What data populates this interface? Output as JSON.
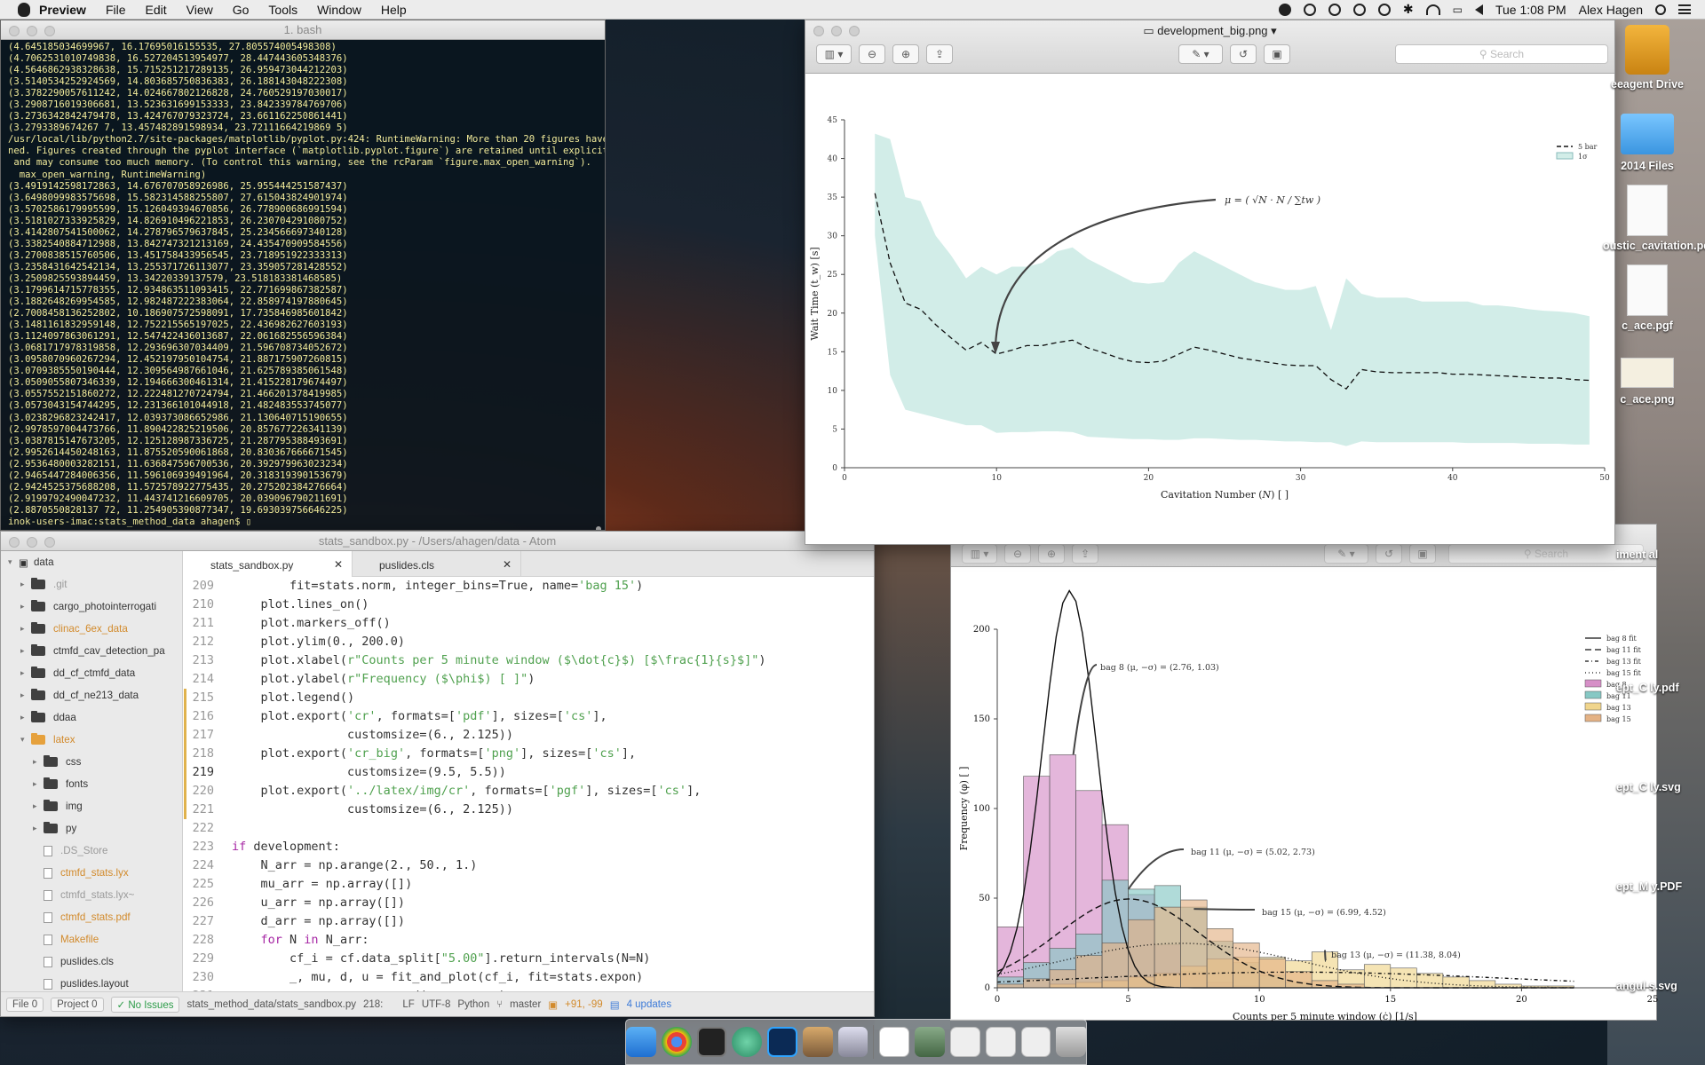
{
  "menubar": {
    "app_name": "Preview",
    "menus": [
      "File",
      "Edit",
      "View",
      "Go",
      "Tools",
      "Window",
      "Help"
    ],
    "clock": "Tue 1:08 PM",
    "user": "Alex Hagen"
  },
  "terminal": {
    "title": "1. bash",
    "lines": [
      "(4.645185034699967, 16.17695016155535, 27.805574005498308)",
      "(4.7062531010749838, 16.527204513954977, 28.447443605348376)",
      "(4.5646862938328638, 15.715251217289135, 26.959473044212203)",
      "(3.5140534252924569, 14.803685750836383, 26.188143048222308)",
      "(3.3782290057611242, 14.024667802126828, 24.760529197030017)",
      "(3.2908716019306681, 13.523631699153333, 23.842339784769706)",
      "(3.2736342842479478, 13.424767079323724, 23.661162250861441)",
      "(3.2793389674267 7, 13.457482891598934, 23.72111664219869 5)",
      "/usr/local/lib/python2.7/site-packages/matplotlib/pyplot.py:424: RuntimeWarning: More than 20 figures have been ope",
      "ned. Figures created through the pyplot interface (`matplotlib.pyplot.figure`) are retained until explicitly closed",
      " and may consume too much memory. (To control this warning, see the rcParam `figure.max_open_warning`).",
      "  max_open_warning, RuntimeWarning)",
      "(3.4919142598172863, 14.676707058926986, 25.955444251587437)",
      "(3.6498099983575698, 15.582314588255807, 27.615043824901974)",
      "(3.5702586179995599, 15.126049394670856, 26.778900686991594)",
      "(3.5181027333925829, 14.826910496221853, 26.230704291080752)",
      "(3.4142807541500062, 14.278796579637845, 25.234566697340128)",
      "(3.3382540884712988, 13.842747321213169, 24.435470909584556)",
      "(3.2700838515760506, 13.451758433956545, 23.718951922333313)",
      "(3.2358431642542134, 13.255371726113077, 23.359057281428552)",
      "(3.2509825593894459, 13.34220339137579, 23.518183381468585)",
      "(3.1799614715778355, 12.934863511093415, 22.771699867382587)",
      "(3.1882648269954585, 12.982487222383064, 22.858974197880645)",
      "(2.7008458136252802, 10.186907572598091, 17.735846985601842)",
      "(3.1481161832959148, 12.752215565197025, 22.436982627603193)",
      "(3.1124097863061291, 12.547422436013687, 22.061682556596384)",
      "(3.0681717978319858, 12.293696307034409, 21.596708734052672)",
      "(3.0958070960267294, 12.452197950104754, 21.887175907260815)",
      "(3.0709385550190444, 12.309564987661046, 21.625789385061548)",
      "(3.0509055807346339, 12.194666300461314, 21.415228179674497)",
      "(3.0557552151860272, 12.222481270724794, 21.466201378419985)",
      "(3.0573043154744295, 12.231366101044918, 21.482483553745077)",
      "(3.0238296823242417, 12.039373086652986, 21.130640715190655)",
      "(2.9978597004473766, 11.890422825219506, 20.857677226341139)",
      "(3.0387815147673205, 12.125128987336725, 21.287795388493691)",
      "(2.9952614450248163, 11.875520590061868, 20.830367666671545)",
      "(2.9536480003282151, 11.636847596700536, 20.392979963023234)",
      "(2.9465447284006356, 11.596106939491964, 20.318319390153679)",
      "(2.9424525375688208, 11.572578922775435, 20.275202384276664)",
      "(2.9199792490047232, 11.443741216609705, 20.039096790211691)",
      "(2.8870550828137 72, 11.254905390877347, 19.693039756646225)",
      "inok-users-imac:stats_method_data ahagen$ "
    ]
  },
  "preview1": {
    "title": "development_big.png",
    "search_placeholder": "Search"
  },
  "preview2": {
    "search_placeholder": "Search"
  },
  "atom": {
    "title": "stats_sandbox.py - /Users/ahagen/data - Atom",
    "tree": [
      {
        "label": "data",
        "kind": "root"
      },
      {
        "label": ".git",
        "kind": "folder",
        "lvl": 1,
        "dim": true
      },
      {
        "label": "cargo_photointerrogati",
        "kind": "folder",
        "lvl": 1
      },
      {
        "label": "clinac_6ex_data",
        "kind": "folder",
        "lvl": 1,
        "mod": true
      },
      {
        "label": "ctmfd_cav_detection_pa",
        "kind": "folder",
        "lvl": 1
      },
      {
        "label": "dd_cf_ctmfd_data",
        "kind": "folder",
        "lvl": 1
      },
      {
        "label": "dd_cf_ne213_data",
        "kind": "folder",
        "lvl": 1
      },
      {
        "label": "ddaa",
        "kind": "folder",
        "lvl": 1
      },
      {
        "label": "latex",
        "kind": "openfolder",
        "lvl": 1,
        "mod": true
      },
      {
        "label": "css",
        "kind": "folder",
        "lvl": 2
      },
      {
        "label": "fonts",
        "kind": "folder",
        "lvl": 2
      },
      {
        "label": "img",
        "kind": "folder",
        "lvl": 2
      },
      {
        "label": "py",
        "kind": "folder",
        "lvl": 2
      },
      {
        "label": ".DS_Store",
        "kind": "file",
        "lvl": 2,
        "dim": true
      },
      {
        "label": "ctmfd_stats.lyx",
        "kind": "file",
        "lvl": 2,
        "mod": true
      },
      {
        "label": "ctmfd_stats.lyx~",
        "kind": "file",
        "lvl": 2,
        "dim": true
      },
      {
        "label": "ctmfd_stats.pdf",
        "kind": "file",
        "lvl": 2,
        "mod": true
      },
      {
        "label": "Makefile",
        "kind": "file",
        "lvl": 2,
        "mod": true
      },
      {
        "label": "puslides.cls",
        "kind": "file",
        "lvl": 2
      },
      {
        "label": "puslides.layout",
        "kind": "file",
        "lvl": 2
      }
    ],
    "tabs": [
      {
        "label": "stats_sandbox.py",
        "active": true
      },
      {
        "label": "puslides.cls",
        "active": false
      }
    ],
    "code": [
      {
        "n": "209",
        "t": "        fit=stats.norm, integer_bins=True, name='bag 15')"
      },
      {
        "n": "210",
        "t": "    plot.lines_on()"
      },
      {
        "n": "211",
        "t": "    plot.markers_off()"
      },
      {
        "n": "212",
        "t": "    plot.ylim(0., 200.0)"
      },
      {
        "n": "213",
        "t": "    plot.xlabel(r\"Counts per 5 minute window ($\\dot{c}$) [$\\frac{1}{s}$]\")"
      },
      {
        "n": "214",
        "t": "    plot.ylabel(r\"Frequency ($\\phi$) [ ]\")"
      },
      {
        "n": "215",
        "t": "    plot.legend()",
        "mod": true
      },
      {
        "n": "216",
        "t": "    plot.export('cr', formats=['pdf'], sizes=['cs'],",
        "mod": true
      },
      {
        "n": "217",
        "t": "                customsize=(6., 2.125))",
        "mod": true
      },
      {
        "n": "218",
        "t": "    plot.export('cr_big', formats=['png'], sizes=['cs'],",
        "mod": true
      },
      {
        "n": "219",
        "t": "                customsize=(9.5, 5.5))",
        "mod": true,
        "cur": true
      },
      {
        "n": "220",
        "t": "    plot.export('../latex/img/cr', formats=['pgf'], sizes=['cs'],",
        "mod": true
      },
      {
        "n": "221",
        "t": "                customsize=(6., 2.125))",
        "mod": true
      },
      {
        "n": "222",
        "t": ""
      },
      {
        "n": "223",
        "t": "if development:"
      },
      {
        "n": "224",
        "t": "    N_arr = np.arange(2., 50., 1.)"
      },
      {
        "n": "225",
        "t": "    mu_arr = np.array([])"
      },
      {
        "n": "226",
        "t": "    u_arr = np.array([])"
      },
      {
        "n": "227",
        "t": "    d_arr = np.array([])"
      },
      {
        "n": "228",
        "t": "    for N in N_arr:"
      },
      {
        "n": "229",
        "t": "        cf_i = cf.data_split[\"5.00\"].return_intervals(N=N)"
      },
      {
        "n": "230",
        "t": "        _, mu, d, u = fit_and_plot(cf_i, fit=stats.expon)"
      },
      {
        "n": "231",
        "t": "        mu_arr = np.append(mu_arr, mu)"
      }
    ],
    "status": {
      "file": "File 0",
      "project": "Project 0",
      "issues": "✓ No Issues",
      "path": "stats_method_data/stats_sandbox.py",
      "pos": "218:",
      "eol": "LF",
      "enc": "UTF-8",
      "lang": "Python",
      "branch": "master",
      "diff": "+91, -99",
      "updates": "4 updates"
    }
  },
  "desktop_icons": [
    {
      "label": "eeagent Drive",
      "kind": "drive"
    },
    {
      "label": "2014 Files",
      "kind": "folder"
    },
    {
      "label": "oustic_cavitation.pdf",
      "kind": "pdf"
    },
    {
      "label": "c_ace.pgf",
      "kind": "doc"
    },
    {
      "label": "c_ace.png",
      "kind": "png"
    },
    {
      "label": "iment al",
      "kind": "partial"
    },
    {
      "label": "ept_C ly.pdf",
      "kind": "partial"
    },
    {
      "label": "ept_C ly.svg",
      "kind": "partial"
    },
    {
      "label": "ept_M y.PDF",
      "kind": "partial"
    },
    {
      "label": "angul s.svg",
      "kind": "partial"
    }
  ],
  "colors": {
    "band": "#d2ede8",
    "bag8": "#d68fc7",
    "bag11": "#86c8c4",
    "bag13": "#f0d58c",
    "bag15": "#e4b285"
  },
  "chart_data": [
    {
      "type": "line",
      "x": [
        2,
        3,
        4,
        5,
        6,
        7,
        8,
        9,
        10,
        11,
        12,
        13,
        14,
        15,
        16,
        17,
        18,
        19,
        20,
        21,
        22,
        23,
        24,
        25,
        26,
        27,
        28,
        29,
        30,
        31,
        32,
        33,
        34,
        35,
        36,
        37,
        38,
        39,
        40,
        41,
        42,
        43,
        44,
        45,
        46,
        47,
        48,
        49
      ],
      "mu": [
        35.5,
        26.5,
        21.3,
        20.5,
        18.5,
        16.8,
        15.2,
        16.2,
        14.7,
        15.2,
        15.8,
        15.8,
        16.2,
        16.5,
        15.5,
        14.9,
        14.2,
        13.7,
        13.6,
        13.8,
        14.7,
        15.6,
        15.2,
        14.7,
        14.2,
        13.9,
        13.6,
        13.3,
        13.2,
        13.2,
        11.4,
        10.2,
        12.7,
        12.4,
        12.3,
        12.3,
        12.3,
        12.3,
        12.1,
        12.1,
        12.0,
        11.9,
        11.8,
        11.7,
        11.6,
        11.6,
        11.4,
        11.3
      ],
      "upper": [
        43.2,
        42.5,
        35.0,
        34.5,
        30.0,
        27.5,
        24.5,
        26.0,
        25.0,
        26.0,
        26.0,
        26.5,
        28.0,
        28.5,
        27.0,
        26.0,
        25.0,
        24.0,
        23.8,
        24.0,
        26.5,
        28.0,
        27.0,
        26.0,
        25.0,
        24.0,
        23.5,
        23.0,
        23.0,
        23.5,
        17.8,
        24.5,
        22.5,
        22.0,
        22.0,
        22.0,
        21.5,
        21.5,
        21.5,
        21.5,
        21.0,
        21.0,
        20.8,
        20.5,
        20.3,
        20.2,
        20.0,
        19.6
      ],
      "lower": [
        30.0,
        12.0,
        7.5,
        7.0,
        6.5,
        6.0,
        5.5,
        5.5,
        4.5,
        4.6,
        4.6,
        4.7,
        4.7,
        4.6,
        4.0,
        3.9,
        3.8,
        3.7,
        3.7,
        3.6,
        3.6,
        3.8,
        3.8,
        3.7,
        3.6,
        3.6,
        3.5,
        3.4,
        3.4,
        3.3,
        3.3,
        2.8,
        3.4,
        3.3,
        3.3,
        3.3,
        3.3,
        3.3,
        3.3,
        3.2,
        3.2,
        3.2,
        3.2,
        3.1,
        3.1,
        3.1,
        3.0,
        3.0
      ],
      "xlabel": "Cavitation Number (𝑁) [ ]",
      "ylabel": "Wait Time (t_w) [s]",
      "xlim": [
        0,
        50
      ],
      "ylim": [
        0,
        45
      ],
      "xticks": [
        0,
        10,
        20,
        30,
        40,
        50
      ],
      "yticks": [
        0,
        5,
        10,
        15,
        20,
        25,
        30,
        35,
        40,
        45
      ],
      "legend": [
        {
          "name": "5 bar"
        },
        {
          "name": "1σ"
        }
      ],
      "annotation": "μ = ( √N · N / ∑tw )"
    },
    {
      "type": "histogram",
      "xlabel": "Counts per 5 minute window (ċ) [1/s]",
      "ylabel": "Frequency (φ) [ ]",
      "xlim": [
        0,
        25
      ],
      "ylim": [
        0,
        200
      ],
      "xticks": [
        0,
        5,
        10,
        15,
        20,
        25
      ],
      "yticks": [
        0,
        50,
        100,
        150,
        200
      ],
      "series": [
        {
          "name": "bag 8",
          "color": "#d68fc7",
          "bins": [
            [
              0,
              1,
              34
            ],
            [
              1,
              2,
              118
            ],
            [
              2,
              3,
              130
            ],
            [
              3,
              4,
              110
            ],
            [
              4,
              5,
              91
            ],
            [
              5,
              6,
              52
            ],
            [
              6,
              7,
              24
            ],
            [
              7,
              8,
              9
            ],
            [
              8,
              9,
              3
            ],
            [
              9,
              10,
              1
            ]
          ],
          "fit_mu": 2.76,
          "fit_sigma": 1.03,
          "fit_label": "bag 8 (μ, −σ) = (2.76, 1.03)"
        },
        {
          "name": "bag 11",
          "color": "#86c8c4",
          "bins": [
            [
              0,
              1,
              6
            ],
            [
              1,
              2,
              14
            ],
            [
              2,
              3,
              22
            ],
            [
              3,
              4,
              30
            ],
            [
              4,
              5,
              60
            ],
            [
              5,
              6,
              55
            ],
            [
              6,
              7,
              57
            ],
            [
              7,
              8,
              45
            ],
            [
              8,
              9,
              26
            ],
            [
              9,
              10,
              14
            ],
            [
              10,
              11,
              7
            ],
            [
              11,
              12,
              3
            ]
          ],
          "fit_mu": 5.02,
          "fit_sigma": 2.73,
          "fit_label": "bag 11 (μ, −σ) = (5.02, 2.73)"
        },
        {
          "name": "bag 13",
          "color": "#f0d58c",
          "bins": [
            [
              2,
              3,
              2
            ],
            [
              3,
              4,
              3
            ],
            [
              4,
              5,
              4
            ],
            [
              5,
              6,
              6
            ],
            [
              6,
              7,
              8
            ],
            [
              7,
              8,
              12
            ],
            [
              8,
              9,
              16
            ],
            [
              9,
              10,
              17
            ],
            [
              10,
              11,
              17
            ],
            [
              11,
              12,
              15
            ],
            [
              12,
              13,
              20
            ],
            [
              13,
              14,
              10
            ],
            [
              14,
              15,
              13
            ],
            [
              15,
              16,
              11
            ],
            [
              16,
              17,
              8
            ],
            [
              17,
              18,
              6
            ],
            [
              18,
              19,
              4
            ],
            [
              19,
              20,
              2
            ],
            [
              20,
              21,
              1
            ],
            [
              21,
              22,
              1
            ]
          ],
          "fit_mu": 11.38,
          "fit_sigma": 8.04,
          "fit_label": "bag 13 (μ, −σ) = (11.38, 8.04)"
        },
        {
          "name": "bag 15",
          "color": "#e4b285",
          "bins": [
            [
              0,
              1,
              2
            ],
            [
              1,
              2,
              5
            ],
            [
              2,
              3,
              10
            ],
            [
              3,
              4,
              18
            ],
            [
              4,
              5,
              25
            ],
            [
              5,
              6,
              38
            ],
            [
              6,
              7,
              45
            ],
            [
              7,
              8,
              49
            ],
            [
              8,
              9,
              33
            ],
            [
              9,
              10,
              25
            ],
            [
              10,
              11,
              16
            ],
            [
              11,
              12,
              9
            ],
            [
              12,
              13,
              4
            ],
            [
              13,
              14,
              2
            ]
          ],
          "fit_mu": 6.99,
          "fit_sigma": 4.52,
          "fit_label": "bag 15 (μ, −σ) = (6.99, 4.52)"
        }
      ],
      "fit_legend": [
        "bag 8 fit",
        "bag 11 fit",
        "bag 13 fit",
        "bag 15 fit"
      ]
    }
  ]
}
